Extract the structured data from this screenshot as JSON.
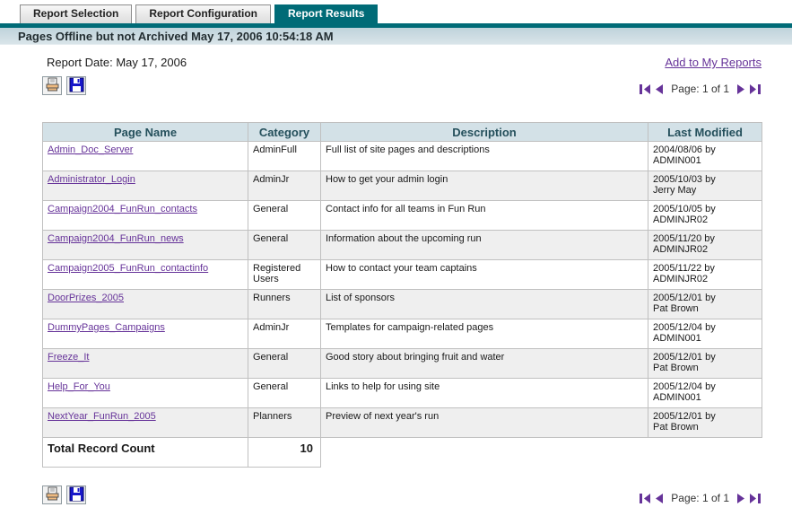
{
  "colors": {
    "accent_teal": "#006b77",
    "link_purple": "#663399",
    "title_bar_bg": "#c9dae1",
    "table_header_bg": "#d3e1e7",
    "row_alt_bg": "#efefef",
    "grid_border": "#c0c0c0"
  },
  "tabs": [
    {
      "label": "Report Selection",
      "active": false
    },
    {
      "label": "Report Configuration",
      "active": false
    },
    {
      "label": "Report Results",
      "active": true
    }
  ],
  "title_bar": "Pages Offline but not Archived May 17, 2006 10:54:18 AM",
  "report": {
    "date_label": "Report Date: May 17, 2006",
    "add_to_my_reports": "Add to My Reports"
  },
  "pagination": {
    "label": "Page: 1 of 1"
  },
  "icons": {
    "print": "print-icon",
    "save": "save-icon",
    "first_page": "first-page-icon",
    "prev_page": "previous-page-icon",
    "next_page": "next-page-icon",
    "last_page": "last-page-icon"
  },
  "table": {
    "headers": [
      "Page Name",
      "Category",
      "Description",
      "Last Modified"
    ],
    "rows": [
      {
        "page_name": "Admin_Doc_Server",
        "category": "AdminFull",
        "description": "Full list of site pages and descriptions",
        "modified": "2004/08/06 by",
        "modified_by": "ADMIN001"
      },
      {
        "page_name": "Administrator_Login",
        "category": "AdminJr",
        "description": "How to get your admin login",
        "modified": "2005/10/03 by",
        "modified_by": "Jerry May"
      },
      {
        "page_name": "Campaign2004_FunRun_contacts",
        "category": "General",
        "description": "Contact info for all teams in Fun Run",
        "modified": "2005/10/05 by",
        "modified_by": "ADMINJR02"
      },
      {
        "page_name": "Campaign2004_FunRun_news",
        "category": "General",
        "description": "Information about the upcoming run",
        "modified": "2005/11/20 by",
        "modified_by": "ADMINJR02"
      },
      {
        "page_name": "Campaign2005_FunRun_contactinfo",
        "category": "Registered Users",
        "description": "How to contact your team captains",
        "modified": "2005/11/22 by",
        "modified_by": "ADMINJR02"
      },
      {
        "page_name": "DoorPrizes_2005",
        "category": "Runners",
        "description": "List of sponsors",
        "modified": "2005/12/01 by",
        "modified_by": "Pat Brown"
      },
      {
        "page_name": "DummyPages_Campaigns",
        "category": "AdminJr",
        "description": "Templates for campaign-related pages",
        "modified": "2005/12/04 by",
        "modified_by": "ADMIN001"
      },
      {
        "page_name": "Freeze_It",
        "category": "General",
        "description": "Good story about bringing fruit and water",
        "modified": "2005/12/01 by",
        "modified_by": "Pat Brown"
      },
      {
        "page_name": "Help_For_You",
        "category": "General",
        "description": "Links to help for using site",
        "modified": "2005/12/04 by",
        "modified_by": "ADMIN001"
      },
      {
        "page_name": "NextYear_FunRun_2005",
        "category": "Planners",
        "description": "Preview of next year's run",
        "modified": "2005/12/01 by",
        "modified_by": "Pat Brown"
      }
    ],
    "total_label": "Total Record Count",
    "total_value": "10"
  }
}
